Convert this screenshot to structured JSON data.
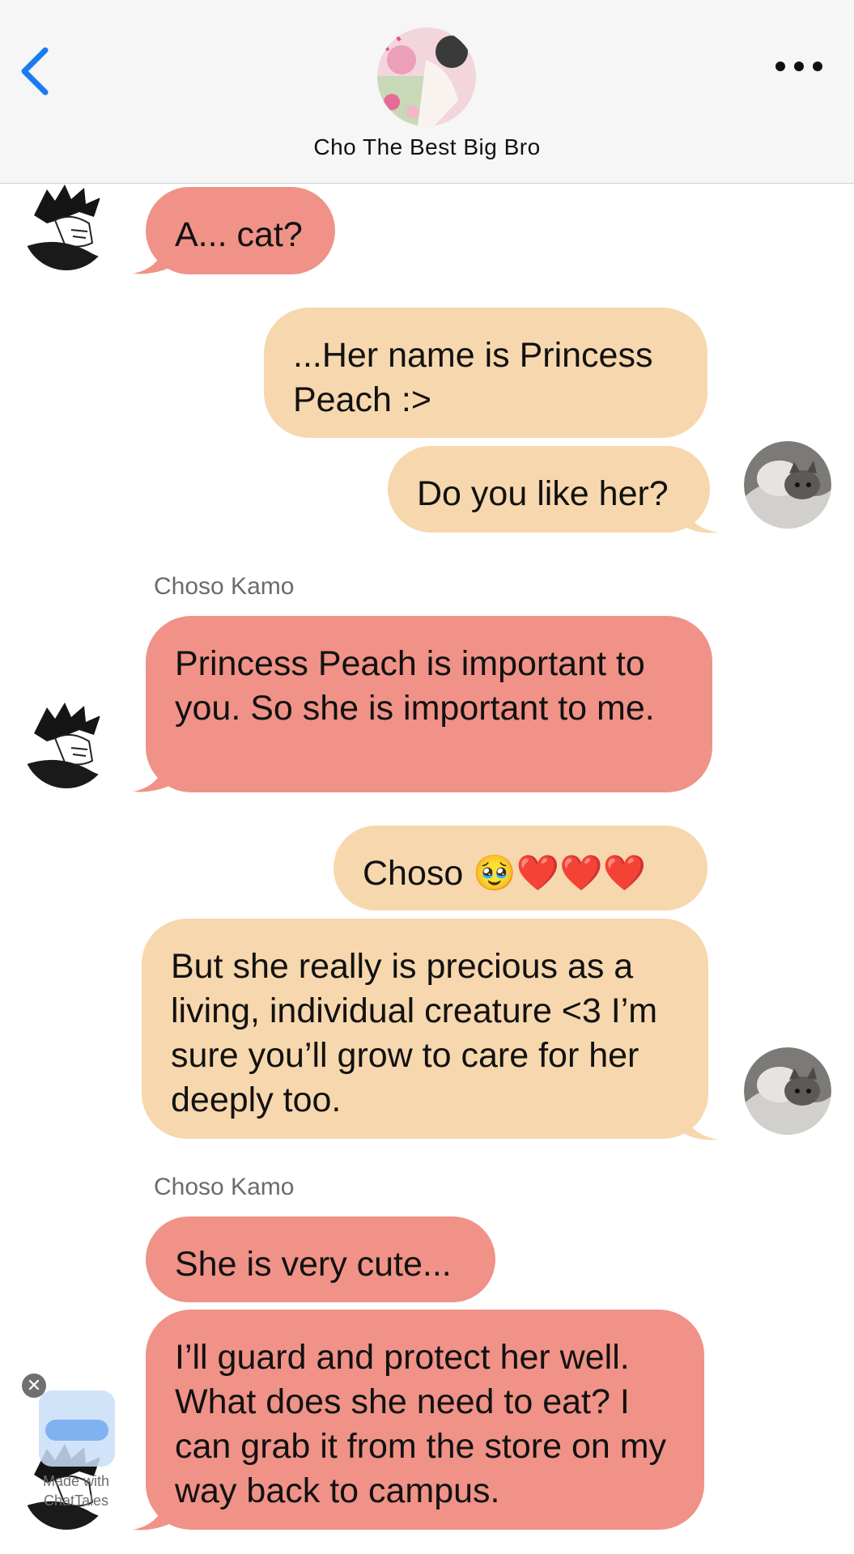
{
  "header": {
    "contact_name": "Cho The Best Big Bro",
    "back_icon": "chevron-left-icon",
    "more_icon": "ellipsis-icon",
    "accent_color": "#1a7cf0"
  },
  "colors": {
    "incoming_bubble": "#f09287",
    "outgoing_bubble": "#f7d7ad"
  },
  "messages": [
    {
      "sender_label": "",
      "text": "A... cat?"
    },
    {
      "sender_label": "",
      "text": "...Her name is Princess Peach :>"
    },
    {
      "sender_label": "",
      "text": "Do you like her?"
    },
    {
      "sender_label": "Choso Kamo",
      "text": "Princess Peach is important to you. So she is important to me."
    },
    {
      "sender_label": "",
      "text": "Choso 🥹❤️❤️❤️"
    },
    {
      "sender_label": "",
      "text": "But she really is precious as a living, individual creature <3 I’m sure you’ll grow to care for her deeply too."
    },
    {
      "sender_label": "Choso Kamo",
      "text": "She is very cute..."
    },
    {
      "sender_label": "",
      "text": "I’ll guard and protect her well. What does she need to eat? I can grab it from the store on my way back to campus."
    }
  ],
  "watermark": {
    "text": "Made with\nChatTales",
    "close_symbol": "✕"
  }
}
